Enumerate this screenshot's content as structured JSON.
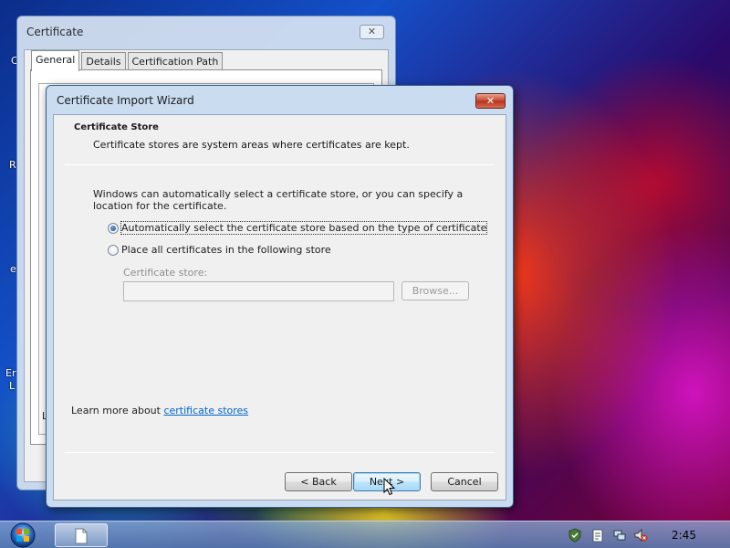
{
  "desktop": {
    "fragments": [
      "C",
      "R",
      "e",
      "Er",
      "L"
    ]
  },
  "certificate_window": {
    "title": "Certificate",
    "close_glyph": "✕",
    "tabs": [
      "General",
      "Details",
      "Certification Path"
    ],
    "active_tab": "General",
    "body_fragment": "Le"
  },
  "wizard": {
    "title": "Certificate Import Wizard",
    "close_glyph": "✕",
    "header_title": "Certificate Store",
    "header_desc": "Certificate stores are system areas where certificates are kept.",
    "intro": "Windows can automatically select a certificate store, or you can specify a location for the certificate.",
    "option_auto": "Automatically select the certificate store based on the type of certificate",
    "option_place": "Place all certificates in the following store",
    "selected_option": "auto",
    "store_label": "Certificate store:",
    "store_value": "",
    "browse_label": "Browse...",
    "learn_prefix": "Learn more about ",
    "learn_link": "certificate stores",
    "back_label": "< Back",
    "next_label": "Next >",
    "cancel_label": "Cancel"
  },
  "taskbar": {
    "clock": "2:45",
    "icons": [
      "start-orb-icon",
      "document-icon",
      "shield-icon",
      "clipboard-icon",
      "network-icon",
      "volume-muted-icon"
    ]
  },
  "colors": {
    "accent": "#3c7fb1",
    "link": "#0066cc",
    "close_red": "#c7452f"
  }
}
